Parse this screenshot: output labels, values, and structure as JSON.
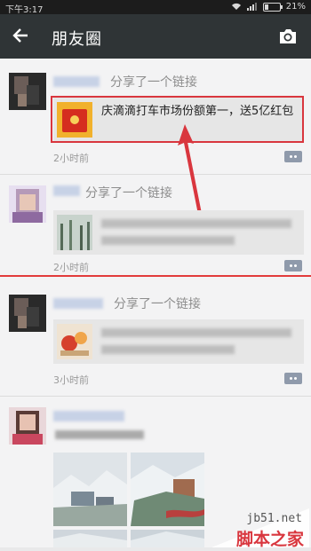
{
  "status_bar": {
    "time": "下午3:17",
    "battery": "21%"
  },
  "header": {
    "title": "朋友圈",
    "back_icon": "arrow-left-icon",
    "camera_icon": "camera-icon"
  },
  "posts": [
    {
      "action": "分享了一个链接",
      "link_text": "庆滴滴打车市场份额第一，送5亿红包",
      "time": "2小时前"
    },
    {
      "action": "分享了一个链接",
      "time": "2小时前"
    },
    {
      "action": "分享了一个链接",
      "time": "3小时前"
    }
  ],
  "watermark": {
    "site": "jb51.net",
    "label": "脚本之家"
  },
  "colors": {
    "appbar": "#2f3436",
    "highlight": "#d9363e",
    "name_blue": "#c7d2e6"
  }
}
